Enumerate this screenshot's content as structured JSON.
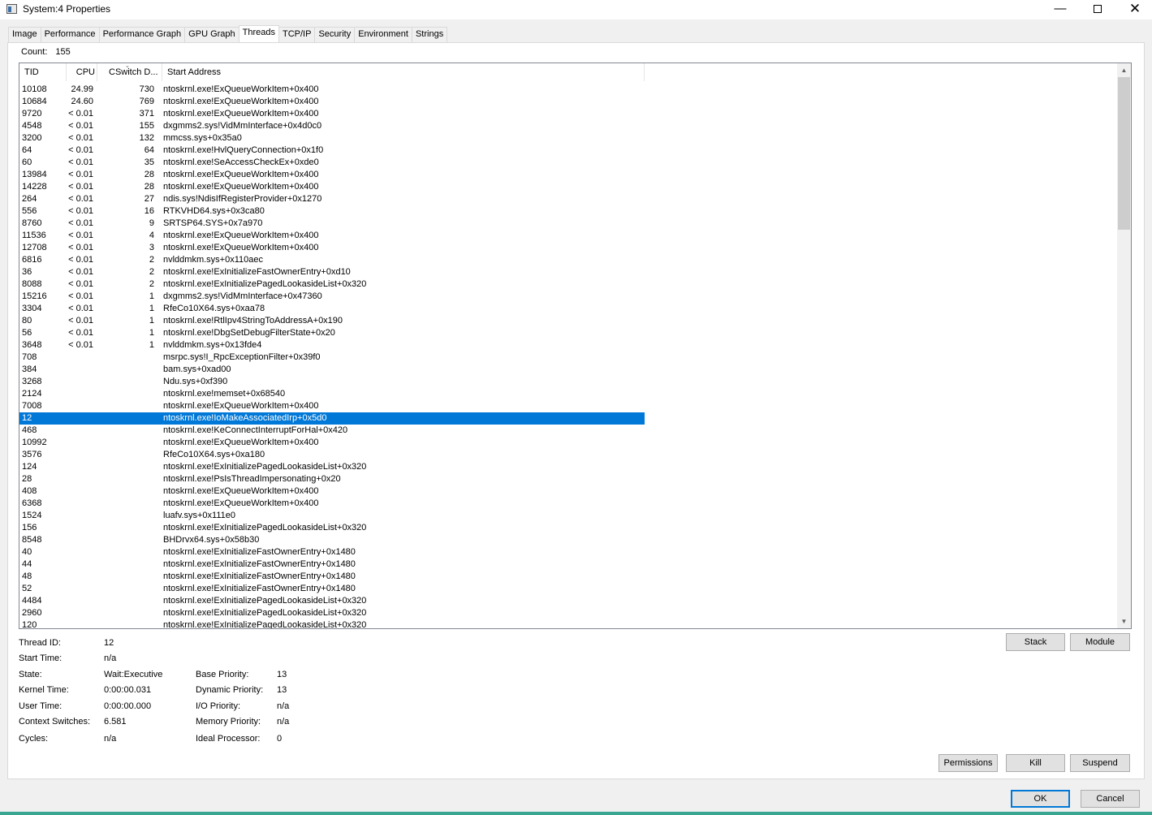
{
  "window": {
    "title": "System:4 Properties",
    "minimize_glyph": "—",
    "close_glyph": "✕"
  },
  "tabs": [
    {
      "label": "Image"
    },
    {
      "label": "Performance"
    },
    {
      "label": "Performance Graph"
    },
    {
      "label": "GPU Graph"
    },
    {
      "label": "Threads",
      "active": true
    },
    {
      "label": "TCP/IP"
    },
    {
      "label": "Security"
    },
    {
      "label": "Environment"
    },
    {
      "label": "Strings"
    }
  ],
  "threads": {
    "count_label": "Count:",
    "count_value": "155",
    "columns": {
      "tid": "TID",
      "cpu": "CPU",
      "cswitch": "CSwitch D...",
      "start": "Start Address"
    },
    "sort_indicator": "⌄",
    "rows": [
      [
        "10108",
        "24.99",
        "730",
        "ntoskrnl.exe!ExQueueWorkItem+0x400"
      ],
      [
        "10684",
        "24.60",
        "769",
        "ntoskrnl.exe!ExQueueWorkItem+0x400"
      ],
      [
        "9720",
        "< 0.01",
        "371",
        "ntoskrnl.exe!ExQueueWorkItem+0x400"
      ],
      [
        "4548",
        "< 0.01",
        "155",
        "dxgmms2.sys!VidMmInterface+0x4d0c0"
      ],
      [
        "3200",
        "< 0.01",
        "132",
        "mmcss.sys+0x35a0"
      ],
      [
        "64",
        "< 0.01",
        "64",
        "ntoskrnl.exe!HvlQueryConnection+0x1f0"
      ],
      [
        "60",
        "< 0.01",
        "35",
        "ntoskrnl.exe!SeAccessCheckEx+0xde0"
      ],
      [
        "13984",
        "< 0.01",
        "28",
        "ntoskrnl.exe!ExQueueWorkItem+0x400"
      ],
      [
        "14228",
        "< 0.01",
        "28",
        "ntoskrnl.exe!ExQueueWorkItem+0x400"
      ],
      [
        "264",
        "< 0.01",
        "27",
        "ndis.sys!NdisIfRegisterProvider+0x1270"
      ],
      [
        "556",
        "< 0.01",
        "16",
        "RTKVHD64.sys+0x3ca80"
      ],
      [
        "8760",
        "< 0.01",
        "9",
        "SRTSP64.SYS+0x7a970"
      ],
      [
        "11536",
        "< 0.01",
        "4",
        "ntoskrnl.exe!ExQueueWorkItem+0x400"
      ],
      [
        "12708",
        "< 0.01",
        "3",
        "ntoskrnl.exe!ExQueueWorkItem+0x400"
      ],
      [
        "6816",
        "< 0.01",
        "2",
        "nvlddmkm.sys+0x110aec"
      ],
      [
        "36",
        "< 0.01",
        "2",
        "ntoskrnl.exe!ExInitializeFastOwnerEntry+0xd10"
      ],
      [
        "8088",
        "< 0.01",
        "2",
        "ntoskrnl.exe!ExInitializePagedLookasideList+0x320"
      ],
      [
        "15216",
        "< 0.01",
        "1",
        "dxgmms2.sys!VidMmInterface+0x47360"
      ],
      [
        "3304",
        "< 0.01",
        "1",
        "RfeCo10X64.sys+0xaa78"
      ],
      [
        "80",
        "< 0.01",
        "1",
        "ntoskrnl.exe!RtlIpv4StringToAddressA+0x190"
      ],
      [
        "56",
        "< 0.01",
        "1",
        "ntoskrnl.exe!DbgSetDebugFilterState+0x20"
      ],
      [
        "3648",
        "< 0.01",
        "1",
        "nvlddmkm.sys+0x13fde4"
      ],
      [
        "708",
        "",
        "",
        "msrpc.sys!I_RpcExceptionFilter+0x39f0"
      ],
      [
        "384",
        "",
        "",
        "bam.sys+0xad00"
      ],
      [
        "3268",
        "",
        "",
        "Ndu.sys+0xf390"
      ],
      [
        "2124",
        "",
        "",
        "ntoskrnl.exe!memset+0x68540"
      ],
      [
        "7008",
        "",
        "",
        "ntoskrnl.exe!ExQueueWorkItem+0x400"
      ],
      [
        "12",
        "",
        "",
        "ntoskrnl.exe!IoMakeAssociatedIrp+0x5d0"
      ],
      [
        "468",
        "",
        "",
        "ntoskrnl.exe!KeConnectInterruptForHal+0x420"
      ],
      [
        "10992",
        "",
        "",
        "ntoskrnl.exe!ExQueueWorkItem+0x400"
      ],
      [
        "3576",
        "",
        "",
        "RfeCo10X64.sys+0xa180"
      ],
      [
        "124",
        "",
        "",
        "ntoskrnl.exe!ExInitializePagedLookasideList+0x320"
      ],
      [
        "28",
        "",
        "",
        "ntoskrnl.exe!PsIsThreadImpersonating+0x20"
      ],
      [
        "408",
        "",
        "",
        "ntoskrnl.exe!ExQueueWorkItem+0x400"
      ],
      [
        "6368",
        "",
        "",
        "ntoskrnl.exe!ExQueueWorkItem+0x400"
      ],
      [
        "1524",
        "",
        "",
        "luafv.sys+0x111e0"
      ],
      [
        "156",
        "",
        "",
        "ntoskrnl.exe!ExInitializePagedLookasideList+0x320"
      ],
      [
        "8548",
        "",
        "",
        "BHDrvx64.sys+0x58b30"
      ],
      [
        "40",
        "",
        "",
        "ntoskrnl.exe!ExInitializeFastOwnerEntry+0x1480"
      ],
      [
        "44",
        "",
        "",
        "ntoskrnl.exe!ExInitializeFastOwnerEntry+0x1480"
      ],
      [
        "48",
        "",
        "",
        "ntoskrnl.exe!ExInitializeFastOwnerEntry+0x1480"
      ],
      [
        "52",
        "",
        "",
        "ntoskrnl.exe!ExInitializeFastOwnerEntry+0x1480"
      ],
      [
        "4484",
        "",
        "",
        "ntoskrnl.exe!ExInitializePagedLookasideList+0x320"
      ],
      [
        "2960",
        "",
        "",
        "ntoskrnl.exe!ExInitializePagedLookasideList+0x320"
      ],
      [
        "120",
        "",
        "",
        "ntoskrnl.exe!ExInitializePagedLookasideList+0x320"
      ]
    ],
    "selected_tid": "12"
  },
  "scrollbar": {
    "up_glyph": "▲",
    "down_glyph": "▼"
  },
  "details": {
    "thread_id_label": "Thread ID:",
    "thread_id": "12",
    "start_time_label": "Start Time:",
    "start_time": "n/a",
    "state_label": "State:",
    "state": "Wait:Executive",
    "kernel_time_label": "Kernel Time:",
    "kernel_time": "0:00:00.031",
    "user_time_label": "User Time:",
    "user_time": "0:00:00.000",
    "context_switches_label": "Context Switches:",
    "context_switches": "6.581",
    "cycles_label": "Cycles:",
    "cycles": "n/a",
    "base_priority_label": "Base Priority:",
    "base_priority": "13",
    "dynamic_priority_label": "Dynamic Priority:",
    "dynamic_priority": "13",
    "io_priority_label": "I/O Priority:",
    "io_priority": "n/a",
    "memory_priority_label": "Memory Priority:",
    "memory_priority": "n/a",
    "ideal_processor_label": "Ideal Processor:",
    "ideal_processor": "0"
  },
  "buttons": {
    "stack": "Stack",
    "module": "Module",
    "permissions": "Permissions",
    "kill": "Kill",
    "suspend": "Suspend",
    "ok": "OK",
    "cancel": "Cancel"
  },
  "colors": {
    "selection": "#0078d7",
    "accent_bottom": "#3aa692"
  }
}
